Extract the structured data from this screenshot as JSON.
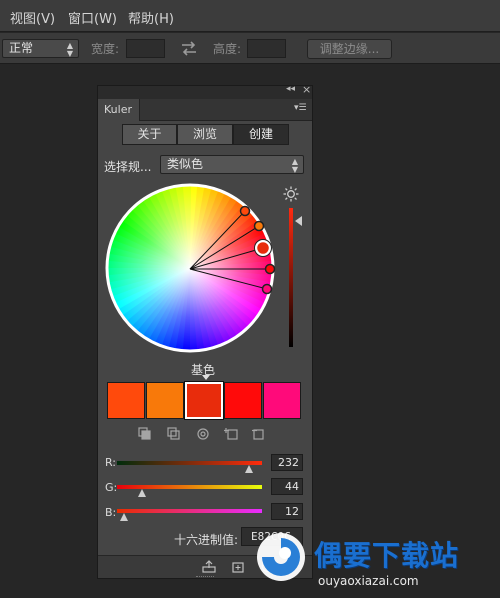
{
  "menubar": {
    "items": [
      "视图(V)",
      "窗口(W)",
      "帮助(H)"
    ]
  },
  "options": {
    "mode_select": "正常",
    "width_label": "宽度:",
    "height_label": "高度:",
    "refine_button": "调整边缘..."
  },
  "panel": {
    "tab_label": "Kuler",
    "segments": [
      "关于",
      "浏览",
      "创建"
    ],
    "active_segment": "创建",
    "rule_label": "选择规...",
    "rule_value": "类似色",
    "base_label": "基色",
    "swatches": [
      "#ff4a0c",
      "#f8790a",
      "#e82c0c",
      "#ff0a0a",
      "#ff0a7a"
    ],
    "selected_swatch": 2,
    "sliders": [
      {
        "label": "R:",
        "value": "232",
        "fraction": 0.91
      },
      {
        "label": "G:",
        "value": "44",
        "fraction": 0.17
      },
      {
        "label": "B:",
        "value": "12",
        "fraction": 0.05
      }
    ],
    "hex_label": "十六进制值:",
    "hex_value": "E82C0C"
  },
  "watermark": {
    "brand": "偶要下载站",
    "url": "ouyaoxiazai.com"
  },
  "colors": {
    "accent_red": "#e82c0c"
  }
}
